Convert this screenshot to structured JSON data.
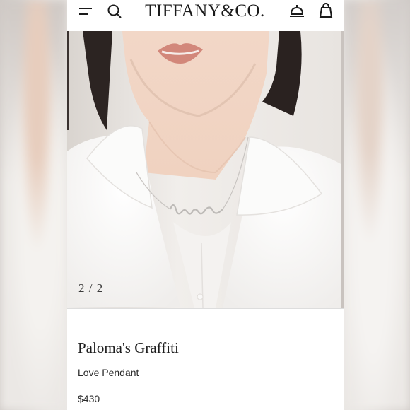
{
  "header": {
    "brand": "TIFFANY&CO.",
    "icons": [
      "menu-icon",
      "search-icon",
      "service-bell-icon",
      "shopping-bag-icon"
    ]
  },
  "gallery": {
    "current": "2",
    "separator": "/",
    "total": "2",
    "image_alt": "Model wearing Love Pendant necklace"
  },
  "product": {
    "name": "Paloma's Graffiti",
    "subtitle": "Love Pendant",
    "price": "$430"
  },
  "colors": {
    "text": "#1e1e1e",
    "background": "#ffffff"
  }
}
